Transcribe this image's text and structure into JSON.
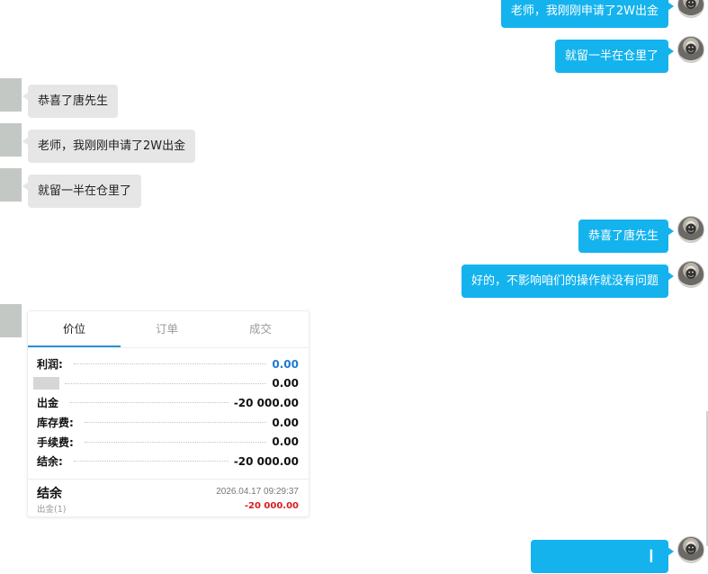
{
  "messages": {
    "m1": "老师，我刚刚申请了2W出金",
    "m2": "就留一半在仓里了",
    "m3": "恭喜了唐先生",
    "m4": "老师，我刚刚申请了2W出金",
    "m5": "就留一半在仓里了",
    "m6": "恭喜了唐先生",
    "m7": "好的，不影响咱们的操作就没有问题"
  },
  "card": {
    "tabs": [
      "价位",
      "订单",
      "成交"
    ],
    "active_tab": "价位",
    "rows": [
      {
        "label": "利润:",
        "value": "0.00"
      },
      {
        "label": "",
        "value": "0.00"
      },
      {
        "label": "出金",
        "value": "-20 000.00"
      },
      {
        "label": "库存费:",
        "value": "0.00"
      },
      {
        "label": "手续费:",
        "value": "0.00"
      },
      {
        "label": "结余:",
        "value": "-20 000.00"
      }
    ],
    "footer": {
      "title": "结余",
      "subtitle": "出金(1)",
      "timestamp": "2026.04.17 09:29:37",
      "amount": "-20 000.00"
    }
  },
  "colors": {
    "bubble_out": "#14b3ee",
    "bubble_in": "#e6e6e6",
    "profit_blue": "#1e7bd0",
    "negative_red": "#d81e1e"
  },
  "icons": {
    "avatar": "user-avatar-icon",
    "cursor": "text-cursor-icon"
  }
}
